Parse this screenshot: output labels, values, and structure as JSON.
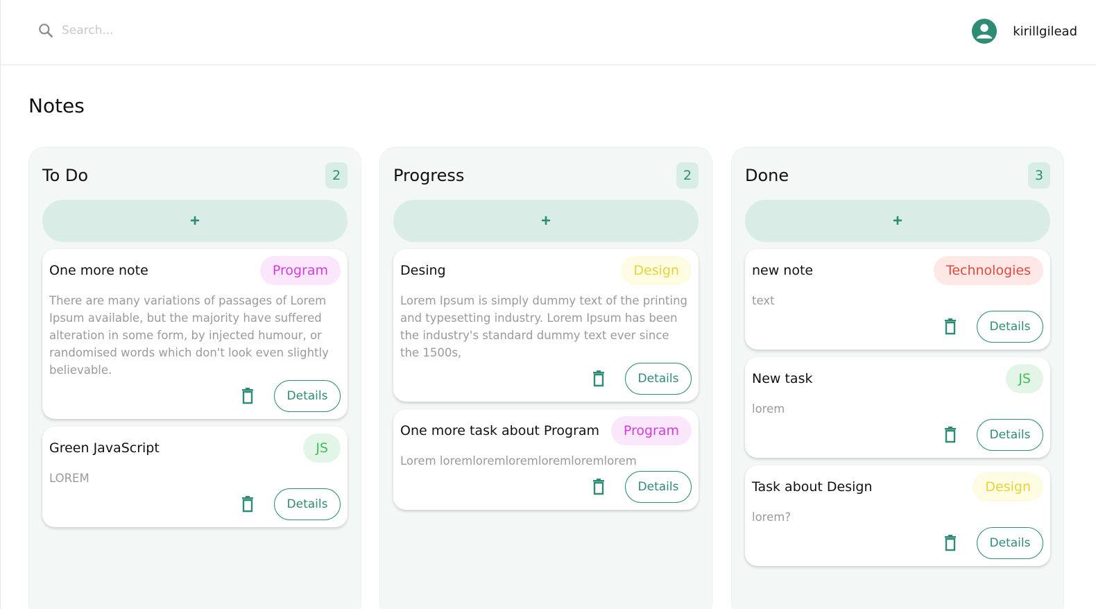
{
  "search": {
    "placeholder": "Search..."
  },
  "user": {
    "name": "kirillgilead"
  },
  "page": {
    "title": "Notes"
  },
  "colors": {
    "accent": "#2e8b74",
    "column_bg": "#f3f8f6",
    "add_bg": "#d9ede6"
  },
  "columns": [
    {
      "title": "To Do",
      "count": "2",
      "add_label": "+",
      "cards": [
        {
          "title": "One more note",
          "tag": "Program",
          "body": "There are many variations of passages of Lorem Ipsum available, but the majority have suffered alteration in some form, by injected humour, or randomised words which don't look even slightly believable.",
          "details_label": "Details"
        },
        {
          "title": "Green JavaScript",
          "tag": "JS",
          "body": "LOREM",
          "details_label": "Details"
        }
      ]
    },
    {
      "title": "Progress",
      "count": "2",
      "add_label": "+",
      "cards": [
        {
          "title": "Desing",
          "tag": "Design",
          "body": "Lorem Ipsum is simply dummy text of the printing and typesetting industry. Lorem Ipsum has been the industry's standard dummy text ever since the 1500s,",
          "details_label": "Details"
        },
        {
          "title": "One more task about Program",
          "tag": "Program",
          "body": "Lorem loremloremloremloremloremlorem",
          "details_label": "Details"
        }
      ]
    },
    {
      "title": "Done",
      "count": "3",
      "add_label": "+",
      "cards": [
        {
          "title": "new note",
          "tag": "Technologies",
          "body": "text",
          "details_label": "Details"
        },
        {
          "title": "New task",
          "tag": "JS",
          "body": "lorem",
          "details_label": "Details"
        },
        {
          "title": "Task about Design",
          "tag": "Design",
          "body": "lorem?",
          "details_label": "Details"
        }
      ]
    }
  ]
}
